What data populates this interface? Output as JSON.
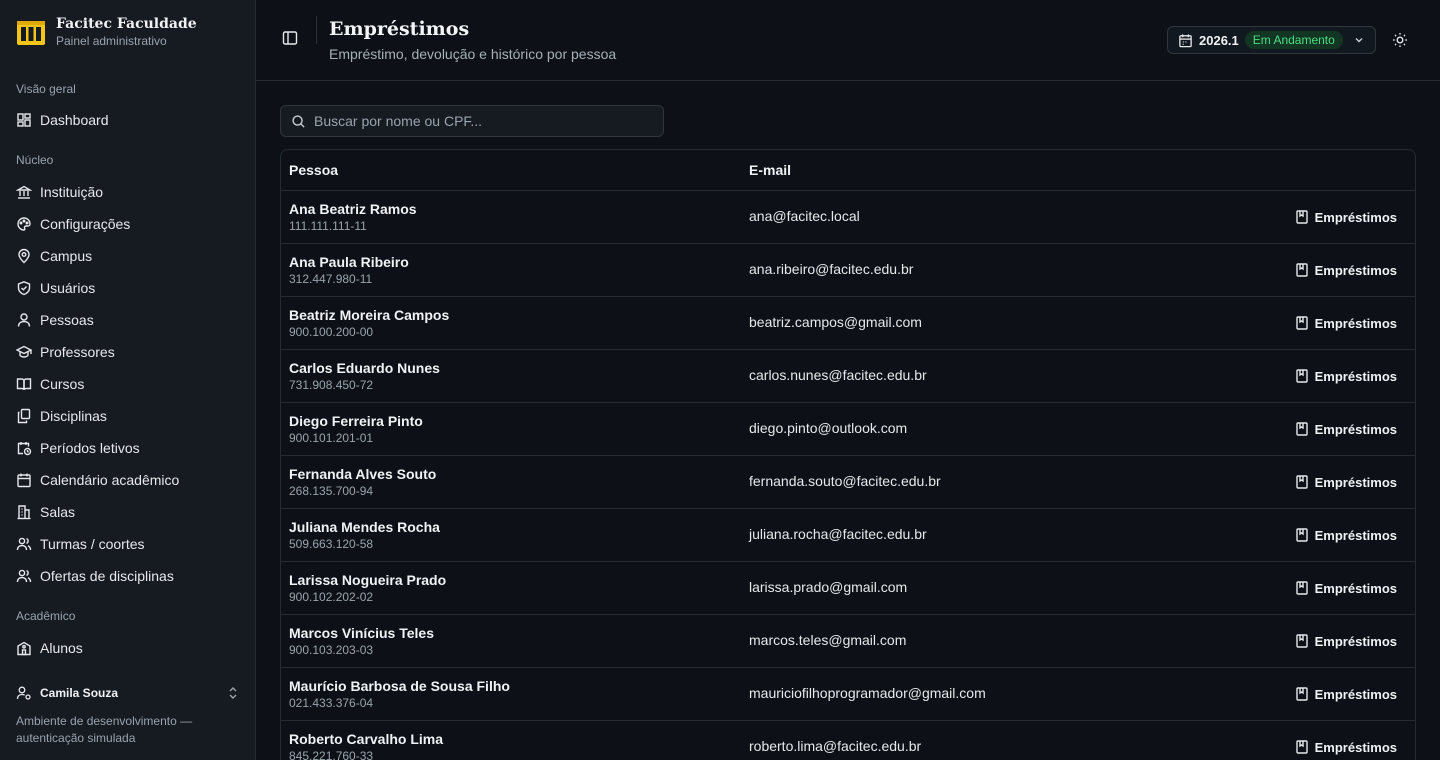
{
  "brand": {
    "title": "Facitec Faculdade",
    "subtitle": "Painel administrativo"
  },
  "sidebar": {
    "groups": [
      {
        "label": "Visão geral",
        "items": [
          {
            "label": "Dashboard",
            "icon": "dashboard-icon"
          }
        ]
      },
      {
        "label": "Núcleo",
        "items": [
          {
            "label": "Instituição",
            "icon": "landmark-icon"
          },
          {
            "label": "Configurações",
            "icon": "palette-icon"
          },
          {
            "label": "Campus",
            "icon": "map-pin-icon"
          },
          {
            "label": "Usuários",
            "icon": "shield-icon"
          },
          {
            "label": "Pessoas",
            "icon": "user-icon"
          },
          {
            "label": "Professores",
            "icon": "graduation-cap-icon"
          },
          {
            "label": "Cursos",
            "icon": "book-open-icon"
          },
          {
            "label": "Disciplinas",
            "icon": "files-icon"
          },
          {
            "label": "Períodos letivos",
            "icon": "calendar-clock-icon"
          },
          {
            "label": "Calendário acadêmico",
            "icon": "calendar-icon"
          },
          {
            "label": "Salas",
            "icon": "building-icon"
          },
          {
            "label": "Turmas / coortes",
            "icon": "users-icon"
          },
          {
            "label": "Ofertas de disciplinas",
            "icon": "users-icon"
          }
        ]
      },
      {
        "label": "Acadêmico",
        "items": [
          {
            "label": "Alunos",
            "icon": "school-icon"
          }
        ]
      }
    ]
  },
  "user": {
    "name": "Camila Souza"
  },
  "env_note": "Ambiente de desenvolvimento — autenticação simulada",
  "header": {
    "title": "Empréstimos",
    "subtitle": "Empréstimo, devolução e histórico por pessoa"
  },
  "period": {
    "year": "2026.1",
    "status": "Em Andamento"
  },
  "search": {
    "placeholder": "Buscar por nome ou CPF..."
  },
  "table": {
    "columns": {
      "person": "Pessoa",
      "email": "E-mail"
    },
    "action_label": "Empréstimos",
    "rows": [
      {
        "name": "Ana Beatriz Ramos",
        "cpf": "111.111.111-11",
        "email": "ana@facitec.local"
      },
      {
        "name": "Ana Paula Ribeiro",
        "cpf": "312.447.980-11",
        "email": "ana.ribeiro@facitec.edu.br"
      },
      {
        "name": "Beatriz Moreira Campos",
        "cpf": "900.100.200-00",
        "email": "beatriz.campos@gmail.com"
      },
      {
        "name": "Carlos Eduardo Nunes",
        "cpf": "731.908.450-72",
        "email": "carlos.nunes@facitec.edu.br"
      },
      {
        "name": "Diego Ferreira Pinto",
        "cpf": "900.101.201-01",
        "email": "diego.pinto@outlook.com"
      },
      {
        "name": "Fernanda Alves Souto",
        "cpf": "268.135.700-94",
        "email": "fernanda.souto@facitec.edu.br"
      },
      {
        "name": "Juliana Mendes Rocha",
        "cpf": "509.663.120-58",
        "email": "juliana.rocha@facitec.edu.br"
      },
      {
        "name": "Larissa Nogueira Prado",
        "cpf": "900.102.202-02",
        "email": "larissa.prado@gmail.com"
      },
      {
        "name": "Marcos Vinícius Teles",
        "cpf": "900.103.203-03",
        "email": "marcos.teles@gmail.com"
      },
      {
        "name": "Maurício Barbosa de Sousa Filho",
        "cpf": "021.433.376-04",
        "email": "mauriciofilhoprogramador@gmail.com"
      },
      {
        "name": "Roberto Carvalho Lima",
        "cpf": "845.221.760-33",
        "email": "roberto.lima@facitec.edu.br"
      }
    ]
  },
  "colors": {
    "accent": "#f5c518",
    "badge_bg": "#123524",
    "badge_text": "#4ade80",
    "bg": "#0d1117",
    "sidebar_bg": "#161b22"
  }
}
